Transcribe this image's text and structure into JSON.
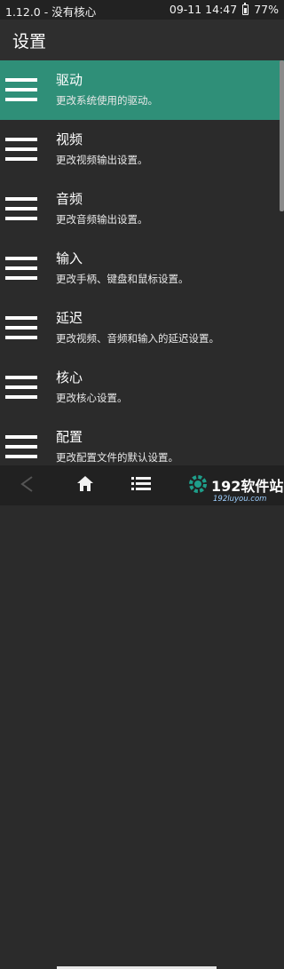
{
  "status_bar": {
    "left_text": "1.12.0 - 没有核心",
    "time": "09-11 14:47",
    "battery": "77%",
    "battery_level": 0.77
  },
  "header": {
    "title": "设置"
  },
  "menu_items": [
    {
      "label": "驱动",
      "desc": "更改系统使用的驱动。",
      "active": true
    },
    {
      "label": "视频",
      "desc": "更改视频输出设置。"
    },
    {
      "label": "音频",
      "desc": "更改音频输出设置。"
    },
    {
      "label": "输入",
      "desc": "更改手柄、键盘和鼠标设置。"
    },
    {
      "label": "延迟",
      "desc": "更改视频、音频和输入的延迟设置。"
    },
    {
      "label": "核心",
      "desc": "更改核心设置。"
    },
    {
      "label": "配置",
      "desc": "更改配置文件的默认设置。"
    }
  ],
  "watermark": {
    "brand": "192软件站",
    "url": "192luyou.com"
  },
  "icons": {
    "menu": "hamburger-icon",
    "back": "back-triangle-icon",
    "home": "home-icon",
    "list": "list-icon",
    "settings": "gear-icon"
  },
  "colors": {
    "accent": "#2f8f78",
    "background": "#2b2b2b"
  }
}
